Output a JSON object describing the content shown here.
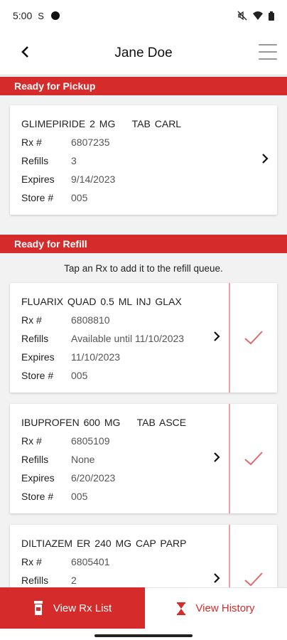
{
  "status_bar": {
    "time": "5:00",
    "s_glyph": "S"
  },
  "header": {
    "title": "Jane Doe"
  },
  "pickup": {
    "section_title": "Ready for Pickup",
    "items": [
      {
        "name": "GLIMEPIRIDE 2 MG    TAB CARL",
        "rx": "6807235",
        "refills": "3",
        "expires": "9/14/2023",
        "store": "005"
      }
    ]
  },
  "refill": {
    "section_title": "Ready for Refill",
    "hint": "Tap an Rx to add it to the refill queue.",
    "items": [
      {
        "name": "FLUARIX QUAD 0.5 ML INJ GLAX",
        "rx": "6808810",
        "refills": "Available until 11/10/2023",
        "expires": "11/10/2023",
        "store": "005"
      },
      {
        "name": "IBUPROFEN 600 MG    TAB ASCE",
        "rx": "6805109",
        "refills": "None",
        "expires": "6/20/2023",
        "store": "005"
      },
      {
        "name": "DILTIAZEM ER 240 MG CAP PARP",
        "rx": "6805401",
        "refills": "2",
        "expires": "",
        "store": ""
      }
    ]
  },
  "labels": {
    "rx": "Rx #",
    "refills": "Refills",
    "expires": "Expires",
    "store": "Store #"
  },
  "bottom_nav": {
    "rx_list_label": "View Rx List",
    "history_label": "View History"
  },
  "colors": {
    "brand_red": "#d62b2b",
    "check_red": "#e06a6a"
  }
}
